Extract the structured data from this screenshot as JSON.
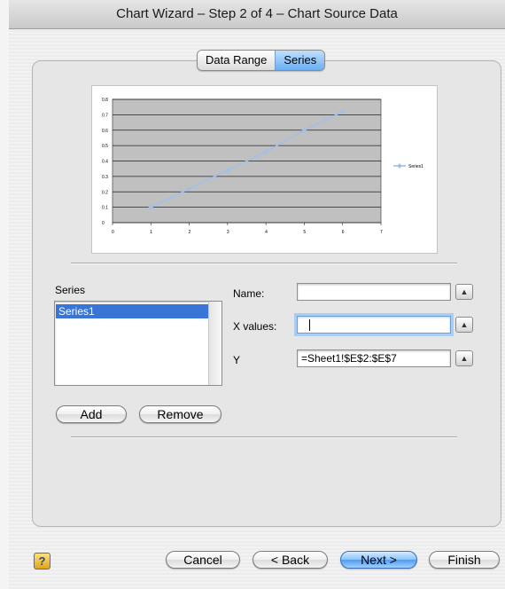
{
  "window": {
    "title": "Chart Wizard – Step 2 of 4 – Chart Source Data"
  },
  "tabs": [
    {
      "label": "Data Range",
      "selected": false
    },
    {
      "label": "Series",
      "selected": true
    }
  ],
  "chart_data": {
    "type": "line",
    "title": "",
    "x": [
      1,
      2,
      3,
      4,
      5,
      6
    ],
    "series": [
      {
        "name": "Series1",
        "values": [
          0.1,
          0.22,
          0.34,
          0.46,
          0.6,
          0.72
        ]
      }
    ],
    "xlim": [
      0,
      7
    ],
    "ylim": [
      0,
      0.8
    ],
    "x_ticks": [
      "0",
      "1",
      "2",
      "3",
      "4",
      "5",
      "6",
      "7"
    ],
    "y_ticks": [
      "0",
      "0.1",
      "0.2",
      "0.3",
      "0.4",
      "0.5",
      "0.6",
      "0.7",
      "0.8"
    ],
    "grid": true,
    "legend": "right",
    "plot_background": "#c0c0c0",
    "series_color": "#9fc0e8"
  },
  "series_panel": {
    "label": "Series",
    "items": [
      "Series1"
    ],
    "selected_index": 0
  },
  "fields": {
    "name": {
      "label": "Name:",
      "value": ""
    },
    "x_values": {
      "label": "X values:",
      "value": ""
    },
    "y": {
      "label": "Y",
      "value": "=Sheet1!$E$2:$E$7"
    }
  },
  "buttons": {
    "add": "Add",
    "remove": "Remove",
    "cancel": "Cancel",
    "back": "< Back",
    "next": "Next >",
    "finish": "Finish",
    "help": "?"
  },
  "icons": {
    "collapse": "collapse-dialog-icon",
    "help": "help-icon"
  }
}
